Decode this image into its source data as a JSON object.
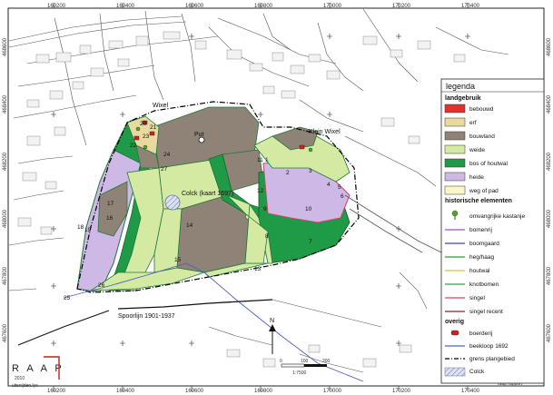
{
  "coords": {
    "top": [
      "169200",
      "169400",
      "169600",
      "169800",
      "170000",
      "170200",
      "170400"
    ],
    "bottom": [
      "169200",
      "169400",
      "169600",
      "169800",
      "170000",
      "170200",
      "170400"
    ],
    "left": [
      "468600",
      "468400",
      "468200",
      "468000",
      "467800",
      "467600",
      "467400"
    ],
    "right": [
      "468600",
      "468400",
      "468200",
      "468000",
      "467800",
      "467600",
      "467400"
    ]
  },
  "places": {
    "wixel": "Wixel",
    "klein_wixel": "Klein Wixel",
    "put": "Put",
    "colck": "Colck (kaart 1697)",
    "spoorlijn": "Spoorlijn 1901-1937"
  },
  "parcel_numbers": [
    "1",
    "2",
    "3",
    "4",
    "5",
    "6",
    "7",
    "8",
    "9",
    "10",
    "11",
    "12",
    "13",
    "14",
    "15",
    "16",
    "17",
    "18",
    "19",
    "20",
    "21",
    "22",
    "23",
    "24",
    "25",
    "26",
    "27"
  ],
  "legend": {
    "title": "legenda",
    "landgebruik_head": "landgebruik",
    "landgebruik": [
      {
        "label": "bebouwd",
        "color": "#e53030"
      },
      {
        "label": "erf",
        "color": "#e8d9a0"
      },
      {
        "label": "bouwland",
        "color": "#8f8276"
      },
      {
        "label": "weide",
        "color": "#d4eaa3"
      },
      {
        "label": "bos of houtwal",
        "color": "#1f9a47"
      },
      {
        "label": "heide",
        "color": "#cdb8e6"
      },
      {
        "label": "weg of pad",
        "color": "#fbf6c8"
      }
    ],
    "historisch_head": "historische elementen",
    "historisch": [
      {
        "label": "omvangrijke kastanje",
        "color": "#5aa02c",
        "kind": "tree"
      },
      {
        "label": "bomenrij",
        "color": "#a04ec8",
        "kind": "line"
      },
      {
        "label": "boomgaard",
        "color": "#3a44c8",
        "kind": "line"
      },
      {
        "label": "heg/haag",
        "color": "#2a9a3a",
        "kind": "line"
      },
      {
        "label": "houtwal",
        "color": "#d8c828",
        "kind": "line"
      },
      {
        "label": "knotbomen",
        "color": "#2aa04a",
        "kind": "line"
      },
      {
        "label": "singel",
        "color": "#e04060",
        "kind": "line"
      },
      {
        "label": "singel recent",
        "color": "#8a2030",
        "kind": "line"
      }
    ],
    "overig_head": "overig",
    "overig": [
      {
        "label": "boerderij",
        "color": "#d02020",
        "kind": "farm"
      },
      {
        "label": "beekloop 1692",
        "color": "#5060c0",
        "kind": "line"
      },
      {
        "label": "grens plangebied",
        "color": "#000000",
        "kind": "dash"
      },
      {
        "label": "Colck",
        "color": "#8090c0",
        "kind": "hatch"
      }
    ]
  },
  "scale": {
    "zero": "0",
    "mid": "100",
    "end": "200",
    "ratio": "1:7500",
    "north": "N"
  },
  "logo": {
    "letters": "R A A P",
    "year": "2010"
  },
  "footer": {
    "left": "uitsnijden.lyx",
    "right": "raap rapport"
  }
}
